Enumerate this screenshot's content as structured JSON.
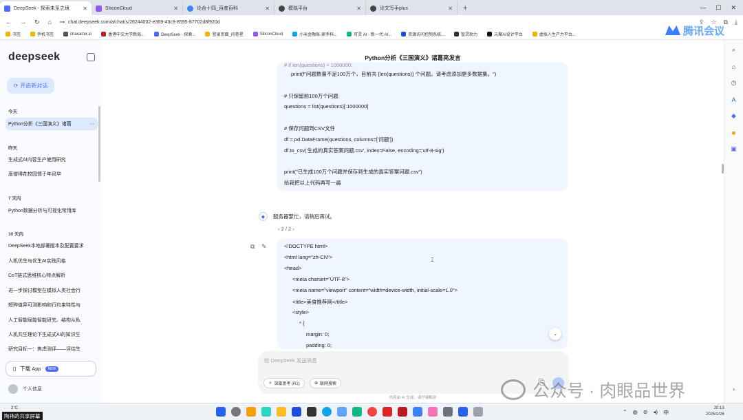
{
  "browser": {
    "tabs": [
      {
        "label": "DeepSeek - 探索未至之境",
        "color": "#4d6bfe"
      },
      {
        "label": "SiliconCloud",
        "color": "#8b5cf6"
      },
      {
        "label": "论合十四_百度百科",
        "color": "#3b82f6"
      },
      {
        "label": "模拟平台",
        "color": "#444444"
      },
      {
        "label": "论文写手plus",
        "color": "#444444"
      }
    ],
    "url": "chat.deepseek.com/a/chat/s/26244002-e369-43c9-8595-87702d8f920d",
    "bookmarks": [
      "书签",
      "手机书签",
      "character.ai",
      "香港中文大学新局...",
      "DeepSeek - 探索...",
      "登录页面_问卷星",
      "SiliconCloud",
      "小米金融账-家手科...",
      "可灵 AI - 新一代 AI...",
      "资源访问控制系统...",
      "智灵助力",
      "元聚AI设计平台",
      "虚拟人生产力平台..."
    ]
  },
  "sidebar": {
    "logo": "deepseek",
    "new_chat": "开启新对话",
    "today": "今天",
    "today_items": [
      "Python分析《三国演义》诸葛"
    ],
    "yesterday": "昨天",
    "yesterday_items": [
      "生成式AI内容生产使用研究",
      "唐僧得花校园情于年风华"
    ],
    "week": "7 天内",
    "week_items": [
      "Python数据分析与可视化常用库"
    ],
    "month": "30 天内",
    "month_items": [
      "DeepSeek本地部署版本及配置要求",
      "人机优生与优生AI实践风格",
      "CoT链式思维核心特点解析",
      "进一步探讨模型在模拟人类社会行",
      "短种值异可测影响和行约束特性与",
      "人工智能赋能智能研究、结构从私",
      "人机共生理论下生成式AI的知识生",
      "研究目标一：焦虑测评——评估生"
    ],
    "download": "下载 App",
    "new_badge": "NEW",
    "profile": "个人信息"
  },
  "chat": {
    "title": "Python分析《三国演义》诸葛亮发言",
    "user_code_lines": [
      "# if len(questions) < 1000000:",
      "    print(f\"问题数量不足100万个，目前共 {len(questions)} 个问题。请考虑添加更多数据集。\")",
      "",
      "# 只保留前100万个问题",
      "questions = list(questions)[:1000000]",
      "",
      "# 保存问题到CSV文件",
      "df = pd.DataFrame(questions, columns=['问题'])",
      "df.to_csv('生成的真实答案问题.csv', index=False, encoding='utf-8-sig')",
      "",
      "print(\"已生成100万个问题并保存到生成的真实答案问题.csv\")",
      "给我把以上代码再写一遍"
    ],
    "bot_reply": "服务器繁忙，请稍后再试。",
    "pager": "‹ 2 / 2 ›",
    "second_code_lines": [
      "<!DOCTYPE html>",
      "<html lang=\"zh-CN\">",
      "<head>",
      "<meta charset=\"UTF-8\">",
      "<meta name=\"viewport\" content=\"width=device-width, initial-scale=1.0\">",
      "<title>美食推荐网</title>",
      "<style>",
      "* {",
      "margin: 0;",
      "padding: 0;"
    ],
    "input_placeholder": "给 DeepSeek 发送消息",
    "deep_think": "深度思考 (R1)",
    "web_search": "联网搜索",
    "footnote": "内容由 AI 生成，请仔细甄别"
  },
  "watermark": {
    "text": "公众号 · 肉眼品世界",
    "corner_logo": "腾讯会议"
  },
  "taskbar": {
    "weather": "2°C",
    "screen_share": "陶祎的共享屏幕",
    "time": "20:13",
    "date": "2025/2/26"
  },
  "colors": {
    "accent": "#4d6bfe",
    "bubble": "#eff6ff",
    "sidebar": "#f9fbff"
  }
}
